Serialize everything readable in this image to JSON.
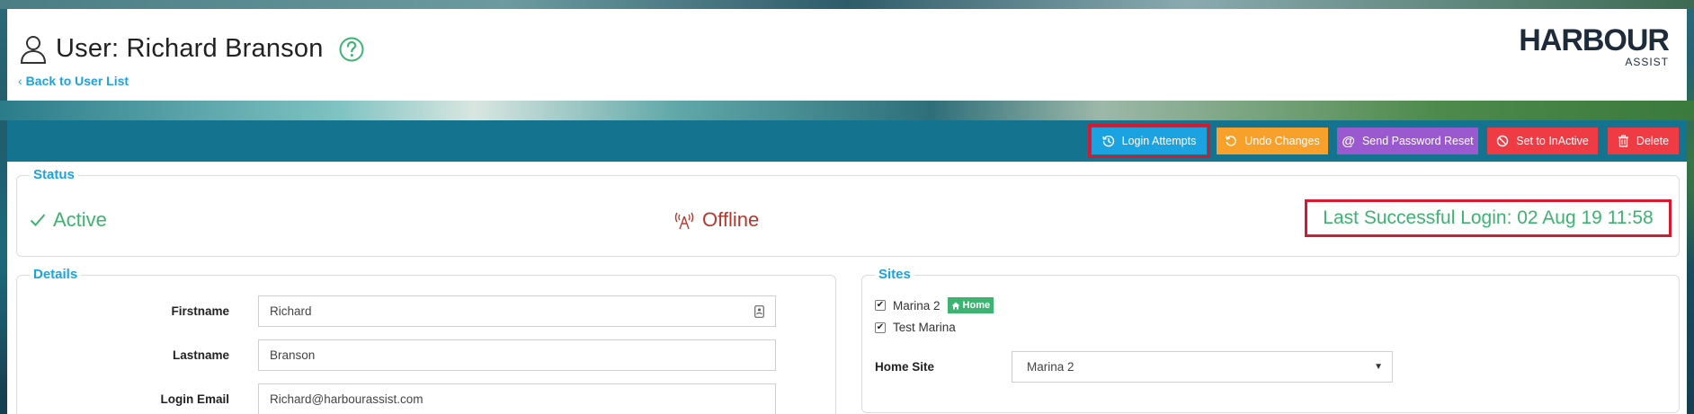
{
  "header": {
    "title": "User: Richard Branson",
    "back_link": "Back to User List",
    "logo_text": "HARBOUR",
    "logo_sub": "ASSIST"
  },
  "toolbar": {
    "login_attempts": "Login Attempts",
    "undo_changes": "Undo Changes",
    "send_password_reset": "Send Password Reset",
    "set_inactive": "Set to InActive",
    "delete": "Delete"
  },
  "status": {
    "legend": "Status",
    "active": "Active",
    "offline": "Offline",
    "last_login": "Last Successful Login: 02 Aug 19 11:58"
  },
  "details": {
    "legend": "Details",
    "firstname_label": "Firstname",
    "firstname_value": "Richard",
    "lastname_label": "Lastname",
    "lastname_value": "Branson",
    "email_label": "Login Email",
    "email_value": "Richard@harbourassist.com"
  },
  "sites": {
    "legend": "Sites",
    "items": [
      {
        "label": "Marina 2",
        "checked": true,
        "badge": "Home"
      },
      {
        "label": "Test Marina",
        "checked": true
      }
    ],
    "home_site_label": "Home Site",
    "home_site_value": "Marina 2"
  },
  "colors": {
    "toolbar": "#14748f",
    "accent_blue": "#1aa3e0",
    "green": "#3cb371",
    "orange": "#f7a12a",
    "purple": "#9b59d0",
    "red": "#ee3b44",
    "highlight": "#d8182f",
    "offline": "#b5382e"
  },
  "icons": [
    "user-icon",
    "help-icon",
    "history-icon",
    "undo-icon",
    "at-icon",
    "ban-icon",
    "trash-icon",
    "check-icon",
    "broadcast-icon",
    "contact-card-icon",
    "home-icon",
    "caret-down-icon"
  ]
}
